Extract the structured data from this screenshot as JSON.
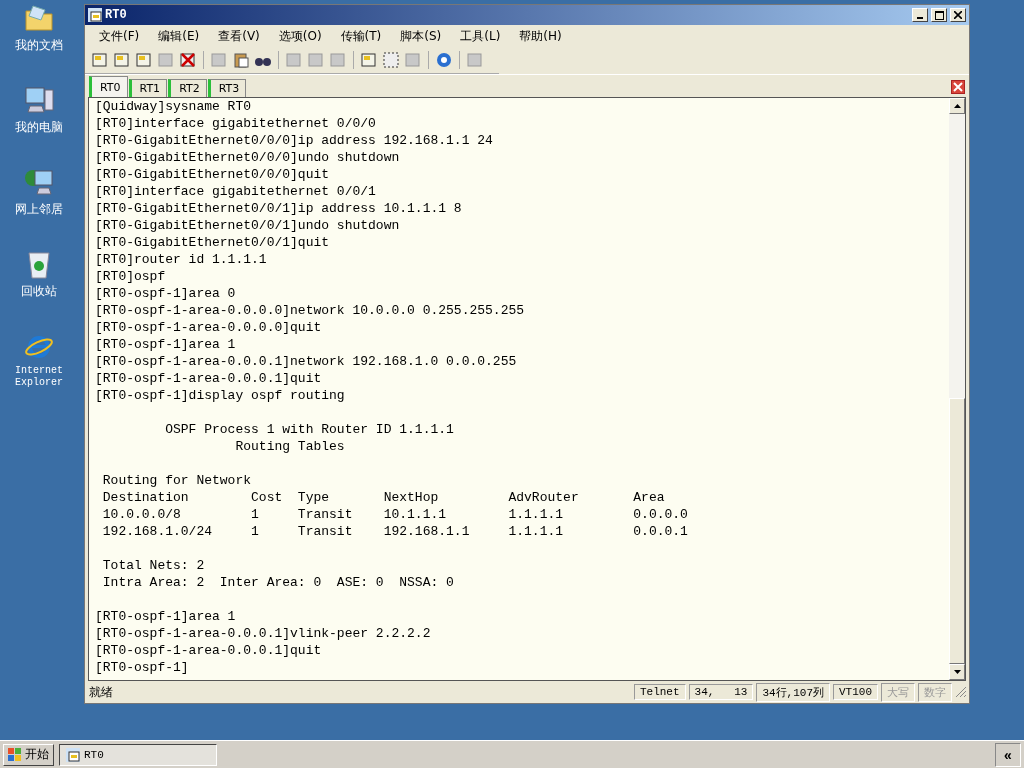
{
  "desktop_icons": [
    {
      "label": "我的文档",
      "kind": "folder"
    },
    {
      "label": "我的电脑",
      "kind": "computer"
    },
    {
      "label": "网上邻居",
      "kind": "network"
    },
    {
      "label": "回收站",
      "kind": "recycle"
    },
    {
      "label": "Internet Explorer",
      "kind": "browser"
    }
  ],
  "window": {
    "title": "RT0"
  },
  "menu": [
    "文件(F)",
    "编辑(E)",
    "查看(V)",
    "选项(O)",
    "传输(T)",
    "脚本(S)",
    "工具(L)",
    "帮助(H)"
  ],
  "tabs": [
    {
      "label": "RT0",
      "selected": true
    },
    {
      "label": "RT1",
      "selected": false
    },
    {
      "label": "RT2",
      "selected": false
    },
    {
      "label": "RT3",
      "selected": false
    }
  ],
  "terminal_blocks": [
    [
      "[Quidway]sysname RT0",
      "[RT0]interface gigabitethernet 0/0/0",
      "[RT0-GigabitEthernet0/0/0]ip address 192.168.1.1 24",
      "[RT0-GigabitEthernet0/0/0]undo shutdown",
      "[RT0-GigabitEthernet0/0/0]quit",
      "[RT0]interface gigabitethernet 0/0/1",
      "[RT0-GigabitEthernet0/0/1]ip address 10.1.1.1 8",
      "[RT0-GigabitEthernet0/0/1]undo shutdown",
      "[RT0-GigabitEthernet0/0/1]quit",
      "[RT0]router id 1.1.1.1",
      "[RT0]ospf",
      "[RT0-ospf-1]area 0",
      "[RT0-ospf-1-area-0.0.0.0]network 10.0.0.0 0.255.255.255",
      "[RT0-ospf-1-area-0.0.0.0]quit",
      "[RT0-ospf-1]area 1",
      "[RT0-ospf-1-area-0.0.0.1]network 192.168.1.0 0.0.0.255",
      "[RT0-ospf-1-area-0.0.0.1]quit",
      "[RT0-ospf-1]display ospf routing"
    ],
    [
      "         OSPF Process 1 with Router ID 1.1.1.1",
      "                  Routing Tables"
    ],
    [
      " Routing for Network",
      " Destination        Cost  Type       NextHop         AdvRouter       Area",
      " 10.0.0.0/8         1     Transit    10.1.1.1        1.1.1.1         0.0.0.0",
      " 192.168.1.0/24     1     Transit    192.168.1.1     1.1.1.1         0.0.0.1"
    ],
    [
      " Total Nets: 2",
      " Intra Area: 2  Inter Area: 0  ASE: 0  NSSA: 0"
    ],
    [
      "[RT0-ospf-1]area 1",
      "[RT0-ospf-1-area-0.0.0.1]vlink-peer 2.2.2.2",
      "[RT0-ospf-1-area-0.0.0.1]quit",
      "[RT0-ospf-1]"
    ]
  ],
  "status_bar": {
    "message": "就绪",
    "panels": [
      {
        "text": "Telnet",
        "disabled": false
      },
      {
        "text": "34,   13",
        "disabled": false
      },
      {
        "text": "34行,107列",
        "disabled": false
      },
      {
        "text": "VT100",
        "disabled": false
      },
      {
        "text": "大写",
        "disabled": true
      },
      {
        "text": "数字",
        "disabled": true
      }
    ]
  },
  "taskbar": {
    "start": "开始",
    "tasks": [
      {
        "label": "RT0",
        "selected": false
      }
    ],
    "tray_toggle": "«"
  }
}
